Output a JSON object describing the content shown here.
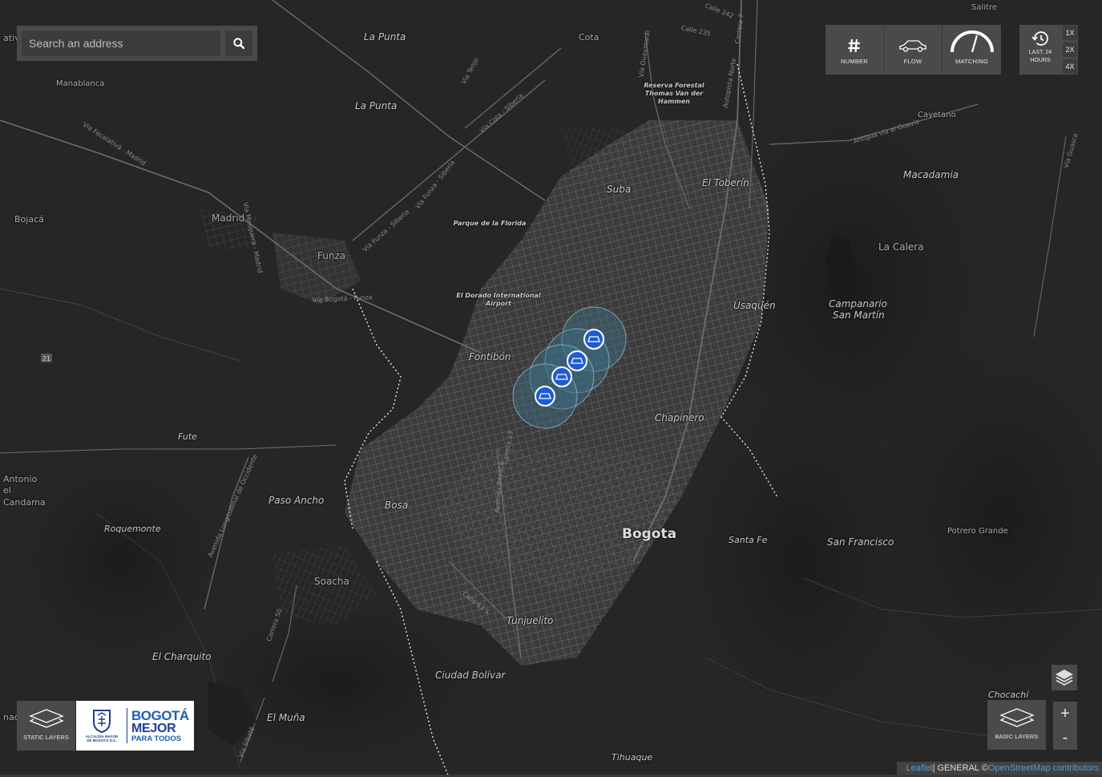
{
  "search": {
    "placeholder": "Search an address"
  },
  "toolbar": {
    "items": [
      {
        "label": "NUMBER",
        "icon": "hash-icon"
      },
      {
        "label": "FLOW",
        "icon": "car-icon"
      },
      {
        "label": "MATCHING",
        "icon": "gauge-icon"
      }
    ]
  },
  "time": {
    "label_line1": "LAST. 24",
    "label_line2": "HOURS",
    "speeds": [
      "1X",
      "2X",
      "4X"
    ]
  },
  "static_layers": {
    "label": "STATIC LAYERS"
  },
  "basic_layers": {
    "label": "BASIC LAYERS"
  },
  "logo": {
    "seal_line1": "ALCALDÍA MAYOR",
    "seal_line2": "DE BOGOTÁ D.C.",
    "line1": "BOGOTÁ",
    "line2": "MEJOR",
    "line3": "PARA TODOS"
  },
  "zoom": {
    "in": "+",
    "out": "-"
  },
  "attribution": {
    "leaflet": "Leaflet",
    "middle": " | GENERAL © ",
    "osm": "OpenStreetMap contributors"
  },
  "map": {
    "place_names": [
      "Salitre",
      "Cota",
      "La Punta",
      "La Punta",
      "Manablanca",
      "Calle 242",
      "Calle 235",
      "Reserva Forestal Thomas Van der Hammen",
      "Cayetano",
      "Macadamia",
      "El Toberín",
      "Suba",
      "Parque de la Florida",
      "Bojacá",
      "Madrid",
      "Funza",
      "La Calera",
      "El Dorado International Airport",
      "Usaquén",
      "Campanario",
      "San Martín",
      "Fontibón",
      "Chapinero",
      "Fute",
      "Paso Ancho",
      "Bosa",
      "Roquemonte",
      "Bogota",
      "Santa Fe",
      "San Francisco",
      "Potrero Grande",
      "Soacha",
      "Tunjuelito",
      "El Charquito",
      "Ciudad Bolívar",
      "El Muña",
      "Chocachí",
      "Tihuaque",
      "Antonio",
      "el",
      "Candama",
      "ativ",
      "nac"
    ],
    "road_names": [
      "Vía Tenjo",
      "Vía Cota - Siberia",
      "Vía Guaymaral",
      "Autopista Norte",
      "Carrera 7",
      "Vía Facatativá - Madrid",
      "Vía Mosquera - Madrid",
      "Vía Funza - Siberia",
      "Vía Funza - Siberia",
      "Vía Bogotá - Funza",
      "Antigua vía al Guavio",
      "Vía Guasca",
      "Avenida Longitudinal de Occidente",
      "Avenida Boyacá",
      "Calle 63 S",
      "Carrera 13",
      "Vía Sibaté",
      "Carrera 50"
    ],
    "route_shield": "21",
    "markers": [
      {
        "label": "vehicle-marker-1"
      },
      {
        "label": "vehicle-marker-2"
      },
      {
        "label": "vehicle-marker-3"
      },
      {
        "label": "vehicle-marker-4"
      }
    ],
    "colors": {
      "background": "#262626",
      "urban": "#5a5a5a",
      "road": "#6d6d6d",
      "marker_circle": "#3b6f86",
      "marker_pin": "#1e5bd6"
    }
  }
}
